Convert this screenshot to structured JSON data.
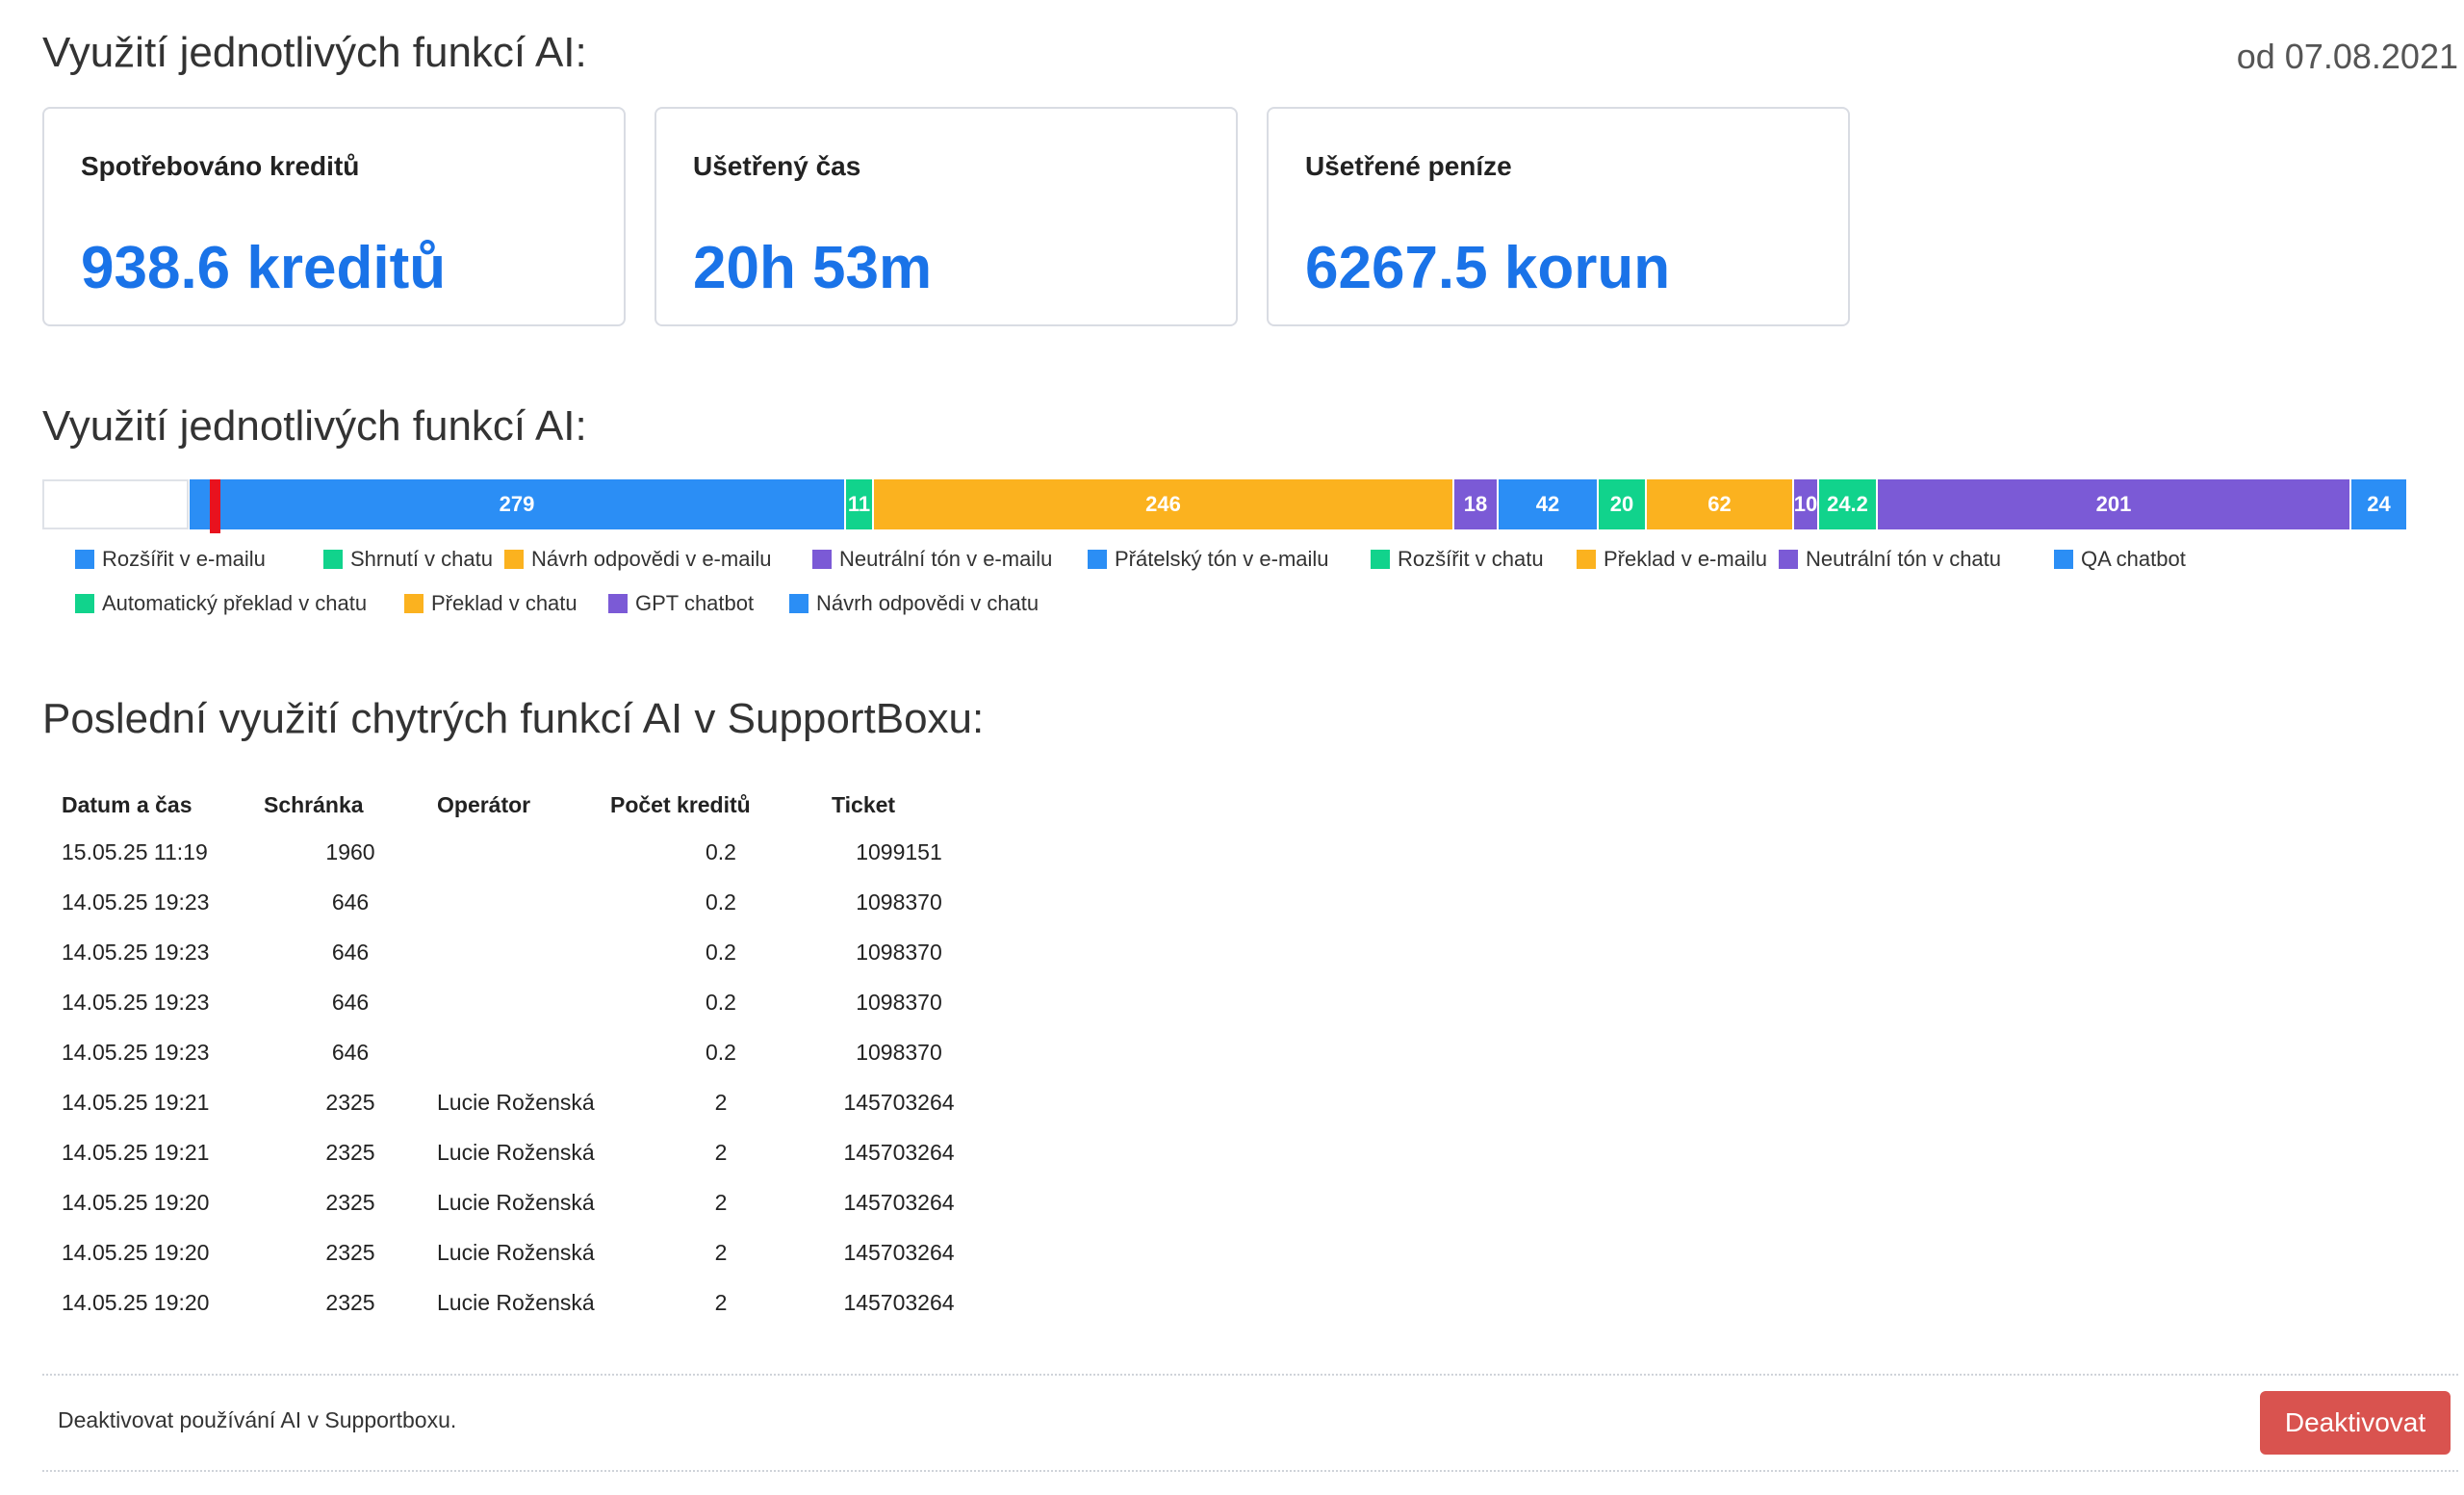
{
  "header": {
    "title": "Využití jednotlivých funkcí AI:",
    "since": "od 07.08.2021"
  },
  "cards": [
    {
      "label": "Spotřebováno kreditů",
      "value": "938.6 kreditů"
    },
    {
      "label": "Ušetřený čas",
      "value": "20h 53m"
    },
    {
      "label": "Ušetřené peníze",
      "value": "6267.5 korun"
    }
  ],
  "usage": {
    "title": "Využití jednotlivých funkcí AI:",
    "colors": {
      "blue": "#2b8ef5",
      "green": "#11d38c",
      "orange": "#fbb21f",
      "purple": "#7b5ad6",
      "red": "#e8121e"
    },
    "segments": [
      {
        "label": "",
        "value": 0,
        "color": "#ffffff"
      },
      {
        "label": "279",
        "value": 279,
        "color": "#2b8ef5"
      },
      {
        "label": "11",
        "value": 11,
        "color": "#11d38c"
      },
      {
        "label": "246",
        "value": 246,
        "color": "#fbb21f"
      },
      {
        "label": "18",
        "value": 18,
        "color": "#7b5ad6"
      },
      {
        "label": "42",
        "value": 42,
        "color": "#2b8ef5"
      },
      {
        "label": "20",
        "value": 20,
        "color": "#11d38c"
      },
      {
        "label": "62",
        "value": 62,
        "color": "#fbb21f"
      },
      {
        "label": "10",
        "value": 10,
        "color": "#7b5ad6"
      },
      {
        "label": "24.2",
        "value": 24.2,
        "color": "#11d38c"
      },
      {
        "label": "201",
        "value": 201,
        "color": "#7b5ad6"
      },
      {
        "label": "24",
        "value": 24,
        "color": "#2b8ef5"
      }
    ],
    "legend": [
      {
        "label": "Rozšířit v e-mailu",
        "color": "#2b8ef5"
      },
      {
        "label": "Shrnutí v chatu",
        "color": "#11d38c"
      },
      {
        "label": "Návrh odpovědi v e-mailu",
        "color": "#fbb21f"
      },
      {
        "label": "Neutrální tón v e-mailu",
        "color": "#7b5ad6"
      },
      {
        "label": "Přátelský tón v e-mailu",
        "color": "#2b8ef5"
      },
      {
        "label": "Rozšířit v chatu",
        "color": "#11d38c"
      },
      {
        "label": "Překlad v e-mailu",
        "color": "#fbb21f"
      },
      {
        "label": "Neutrální tón v chatu",
        "color": "#7b5ad6"
      },
      {
        "label": "QA chatbot",
        "color": "#2b8ef5"
      },
      {
        "label": "Automatický překlad v chatu",
        "color": "#11d38c"
      },
      {
        "label": "Překlad v chatu",
        "color": "#fbb21f"
      },
      {
        "label": "GPT chatbot",
        "color": "#7b5ad6"
      },
      {
        "label": "Návrh odpovědi v chatu",
        "color": "#2b8ef5"
      }
    ]
  },
  "recent": {
    "title": "Poslední využití chytrých funkcí AI v SupportBoxu:",
    "columns": [
      "Datum a čas",
      "Schránka",
      "Operátor",
      "Počet kreditů",
      "Ticket"
    ],
    "rows": [
      [
        "15.05.25 11:19",
        "1960",
        "",
        "0.2",
        "1099151"
      ],
      [
        "14.05.25 19:23",
        "646",
        "",
        "0.2",
        "1098370"
      ],
      [
        "14.05.25 19:23",
        "646",
        "",
        "0.2",
        "1098370"
      ],
      [
        "14.05.25 19:23",
        "646",
        "",
        "0.2",
        "1098370"
      ],
      [
        "14.05.25 19:23",
        "646",
        "",
        "0.2",
        "1098370"
      ],
      [
        "14.05.25 19:21",
        "2325",
        "Lucie Roženská",
        "2",
        "145703264"
      ],
      [
        "14.05.25 19:21",
        "2325",
        "Lucie Roženská",
        "2",
        "145703264"
      ],
      [
        "14.05.25 19:20",
        "2325",
        "Lucie Roženská",
        "2",
        "145703264"
      ],
      [
        "14.05.25 19:20",
        "2325",
        "Lucie Roženská",
        "2",
        "145703264"
      ],
      [
        "14.05.25 19:20",
        "2325",
        "Lucie Roženská",
        "2",
        "145703264"
      ]
    ]
  },
  "footer": {
    "text": "Deaktivovat používání AI v Supportboxu.",
    "button": "Deaktivovat"
  }
}
